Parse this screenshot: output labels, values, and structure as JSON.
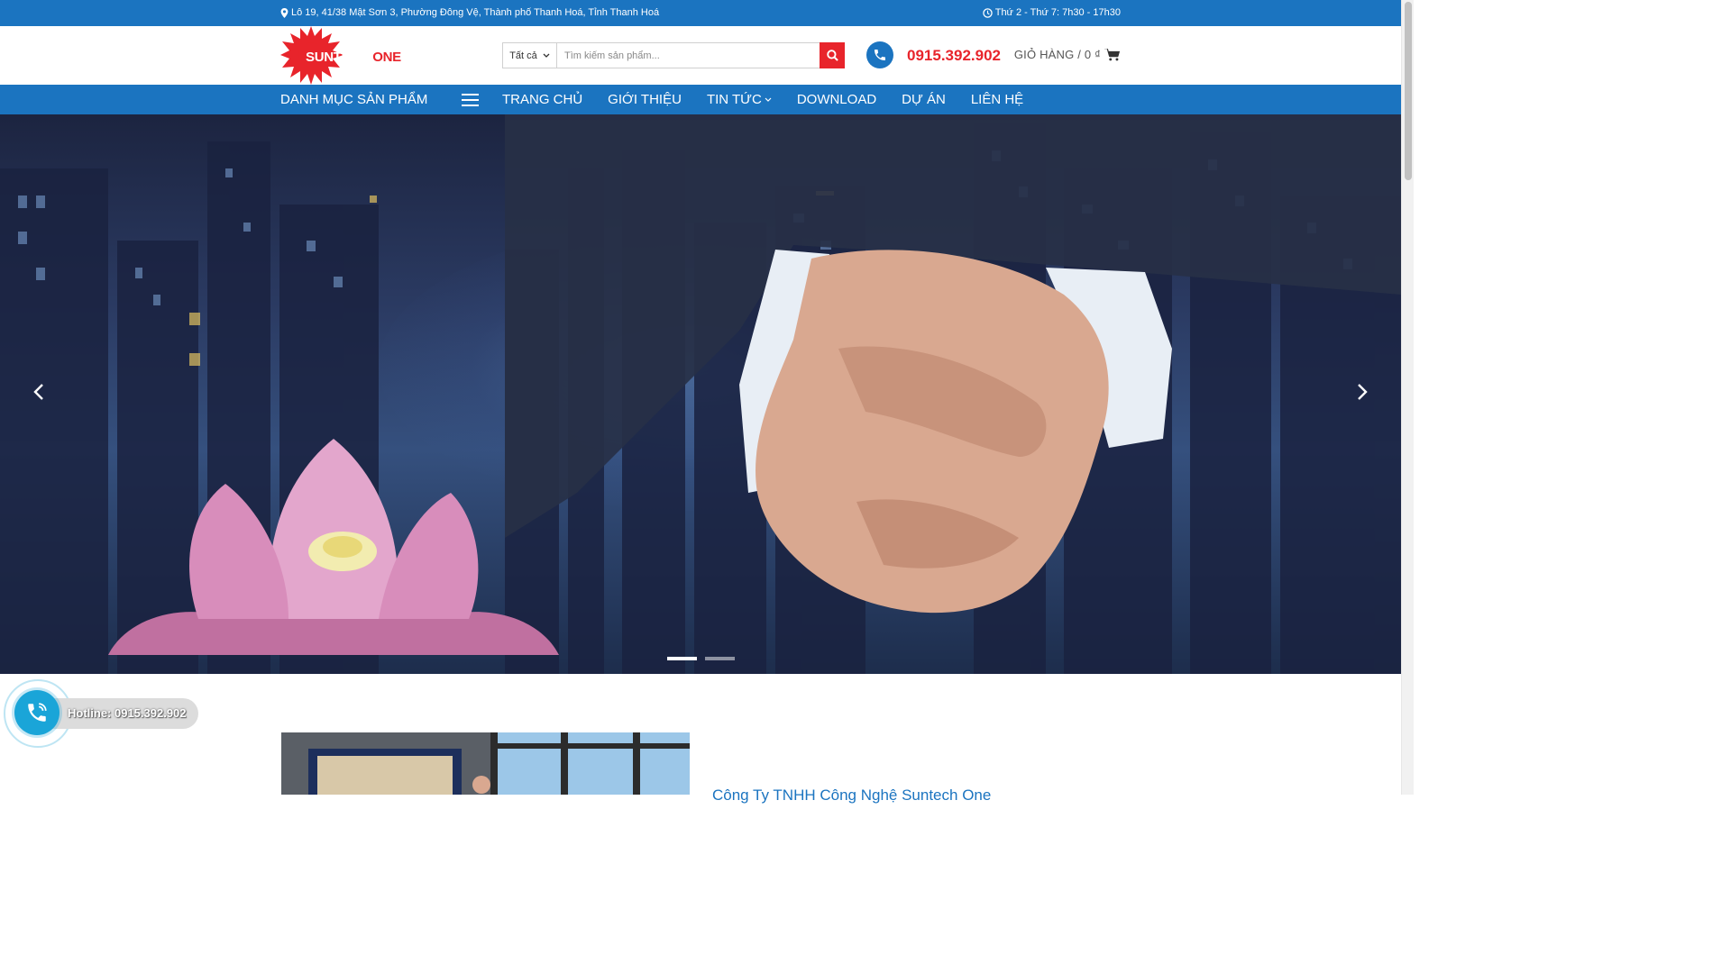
{
  "topbar": {
    "address": "Lô 19, 41/38 Mật Sơn 3, Phường Đông Vệ, Thành phố Thanh Hoá, Tỉnh Thanh Hoá",
    "hours": "Thứ 2 - Thứ 7: 7h30 - 17h30"
  },
  "header": {
    "logo_text_red": "SUNTECH",
    "logo_text_brand": "ONE",
    "search": {
      "category": "Tất cả",
      "placeholder": "Tìm kiếm sản phẩm..."
    },
    "phone": "0915.392.902",
    "cart_label": "GIỎ HÀNG / 0 ₫"
  },
  "nav": {
    "category_title": "DANH MỤC SẢN PHẨM",
    "items": [
      {
        "label": "TRANG CHỦ"
      },
      {
        "label": "GIỚI THIỆU"
      },
      {
        "label": "TIN TỨC"
      },
      {
        "label": "DOWNLOAD"
      },
      {
        "label": "DỰ ÁN"
      },
      {
        "label": "LIÊN HỆ"
      }
    ]
  },
  "hero": {
    "slide_count": 2,
    "active_slide": 1
  },
  "hotline": {
    "label": "Hotline: 0915.392.902"
  },
  "content": {
    "title": "Công Ty TNHH Công Nghệ Suntech One"
  },
  "colors": {
    "primary_blue": "#1b74c0",
    "accent_red": "#e8242b",
    "hotline_blue": "#1aa5d8"
  }
}
